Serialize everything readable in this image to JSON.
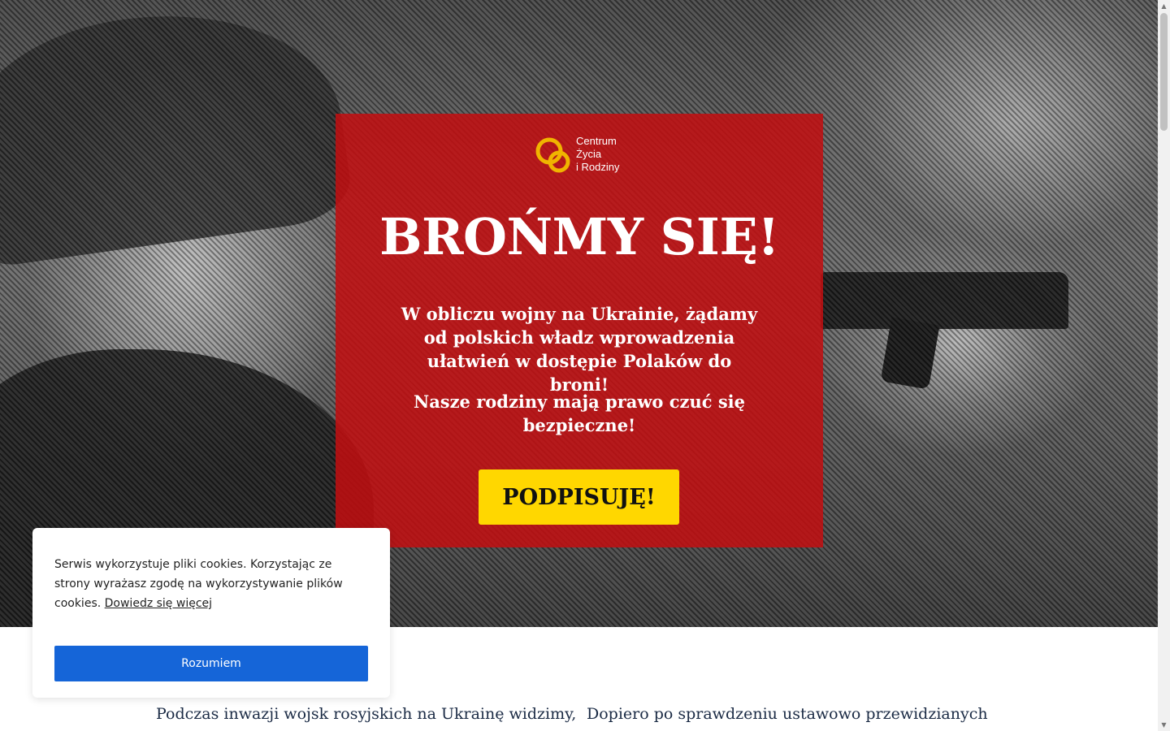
{
  "brand": {
    "line1": "Centrum",
    "line2": "Życia",
    "line3": "i Rodziny",
    "ring_color": "#f0b400"
  },
  "hero": {
    "headline": "BROŃMY SIĘ!",
    "lead": "W obliczu wojny na Ukrainie, żądamy od polskich władz wprowadzenia ułatwień w dostępie Polaków do broni!",
    "lead2": "Nasze rodziny mają prawo czuć się bezpieczne!",
    "cta_label": "PODPISUJĘ!",
    "panel_color": "#c30e10",
    "cta_color": "#ffd700"
  },
  "content": {
    "col_left_first_line": "Podczas inwazji wojsk rosyjskich na Ukrainę widzimy,",
    "col_right_first_line": "Dopiero po sprawdzeniu ustawowo przewidzianych"
  },
  "cookie_banner": {
    "text": "Serwis wykorzystuje pliki cookies. Korzystając ze strony wyrażasz zgodę na wykorzystywanie plików cookies.",
    "link_label": "Dowiedz się więcej",
    "accept_label": "Rozumiem",
    "accept_color": "#1565d8"
  },
  "scrollbar": {
    "up_icon": "▲",
    "down_icon": "▼"
  }
}
